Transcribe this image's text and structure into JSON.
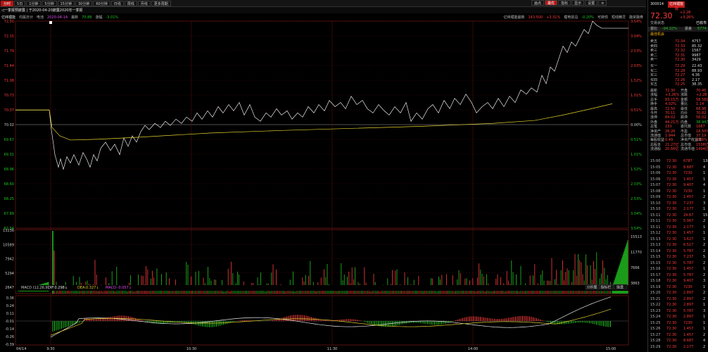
{
  "toolbar": {
    "items": [
      "分时",
      "5日",
      "1分钟",
      "5分钟",
      "15分钟",
      "30分钟",
      "60分钟",
      "日线",
      "周线",
      "月线",
      "更多周期"
    ],
    "active": 0,
    "right_items": [
      "画点",
      "最优",
      "指标",
      "显示",
      "设置",
      "≡"
    ],
    "right_active": 1
  },
  "infobar": {
    "back": "◁一季报预披露 | 于2020-04-20披露2020年一季报",
    "name": "亿纬锂能",
    "trend": "均属日计",
    "vol_label": "电池",
    "date_hint": "2020-04-14",
    "last_label": "最新",
    "last": "70.88",
    "change_label": "涨幅",
    "change": "-3.01%",
    "right_label": "亿纬锂能最新",
    "right_value": "143.500",
    "right_change": "+3.31%",
    "sector_label": "锂电前沿",
    "sector_change": "-0.20%",
    "tabs": [
      "可转债",
      "短线精灵",
      "融资融券"
    ]
  },
  "main_chart": {
    "y_left": [
      "72.50",
      "72.15",
      "71.79",
      "71.44",
      "71.08",
      "70.73",
      "70.37",
      "70.02",
      "69.67",
      "69.31",
      "68.96",
      "68.60",
      "68.25",
      "67.89",
      "67.54"
    ],
    "y_right": [
      "3.54%",
      "3.04%",
      "2.53%",
      "2.03%",
      "1.52%",
      "1.01%",
      "0.51%",
      "0.00%",
      "0.51%",
      "1.01%",
      "1.52%",
      "2.03%",
      "2.53%",
      "3.04%",
      "3.54%"
    ],
    "prev_close": 70.02,
    "ylim": [
      67.54,
      72.5
    ]
  },
  "vol_chart": {
    "y_left": [
      "13236",
      "10589",
      "7942",
      "5294",
      "2647"
    ],
    "y_right": [
      "15513",
      "11770",
      "7666",
      "3863"
    ]
  },
  "macd": {
    "label": "MACD (12,26,9)",
    "dif_label": "DIF:",
    "dif": "0.298↓",
    "dea_label": "DEA:",
    "dea": "0.327↓",
    "macd_label": "MACD:",
    "macd": "-0.057↓",
    "y_left": [
      "0.36",
      "0.24",
      "0.11",
      "-0.01",
      "-0.14",
      "-0.26",
      "-0.39"
    ],
    "bottom_tabs": [
      "分析图",
      "指标栏",
      "操盘"
    ]
  },
  "time_axis": [
    "04/14",
    "9:30",
    "10:30",
    "11:30",
    "14:00",
    "15:00"
  ],
  "sidebar": {
    "code": "300014",
    "name": "亿纬锂能",
    "alt": "融",
    "price": "72.30",
    "chg": "+2.28",
    "pct": "+3.26%",
    "status_label": "交易状态",
    "status": "已收市",
    "weibi_label": "委比",
    "weibi": "-94.32%",
    "weicha_label": "委差",
    "weicha": "6774",
    "marked_label": "最佳机会",
    "marked2": "新品发布",
    "asks": [
      [
        "卖五",
        "72.34",
        "4757"
      ],
      [
        "卖四",
        "72.33",
        "85.32"
      ],
      [
        "卖三",
        "72.32",
        "1567"
      ],
      [
        "卖二",
        "72.31",
        "9987"
      ],
      [
        "卖一",
        "72.30",
        "3429"
      ]
    ],
    "bids": [
      [
        "买一",
        "72.29",
        "22.43"
      ],
      [
        "买二",
        "72.28",
        "88.93"
      ],
      [
        "买三",
        "72.27",
        "4.36"
      ],
      [
        "买四",
        "72.26",
        "2.17"
      ],
      [
        "买五",
        "72.25",
        "38.35"
      ]
    ],
    "stats": [
      [
        "最新",
        "72.30",
        "开盘",
        "70.45"
      ],
      [
        "涨幅",
        "+3.26%",
        "涨跌",
        "+2.28"
      ],
      [
        "总手",
        "83.15万",
        "金额",
        "58.58亿"
      ],
      [
        "换手",
        "4.02%",
        "量比",
        "1.14"
      ],
      [
        "最高",
        "72.50",
        "最低",
        "68.98"
      ],
      [
        "今开",
        "70.11",
        "均价",
        "70.82"
      ],
      [
        "涨停",
        "84.02",
        "跌停",
        "56.02"
      ],
      [
        "外盘",
        "44.21万",
        "内盘",
        "38.94万"
      ],
      [
        "总笔",
        "233",
        "委托数",
        "1687"
      ],
      [
        "净资产",
        "28.26",
        "市盈",
        "18.50%"
      ],
      [
        "流通值",
        "1.944",
        "总市值",
        "37.19"
      ],
      [
        "每股收益",
        "0.49",
        "净资产收益率",
        "0.66%"
      ],
      [
        "总股本",
        "21.27亿",
        "总市值",
        "1538亿"
      ],
      [
        "流通股",
        "20.66亿",
        "流通市值",
        "1494亿"
      ]
    ],
    "ticks": [
      [
        "15:00",
        "72.30",
        "6787",
        "1383"
      ],
      [
        "15:05",
        "72.30",
        "8.687",
        "4"
      ],
      [
        "15:06",
        "72.30",
        "7230",
        "1"
      ],
      [
        "15:06",
        "72.30",
        "1.457",
        "1"
      ],
      [
        "15:07",
        "72.30",
        "9.407",
        "4"
      ],
      [
        "15:08",
        "72.30",
        "7230",
        "1"
      ],
      [
        "15:09",
        "72.30",
        "1.457",
        "2"
      ],
      [
        "15:10",
        "72.30",
        "7.237",
        "3"
      ],
      [
        "15:10",
        "72.30",
        "2.177",
        "1"
      ],
      [
        "15:11",
        "72.30",
        "29.67",
        "15"
      ],
      [
        "15:11",
        "72.30",
        "5.067",
        "2"
      ],
      [
        "15:11",
        "72.30",
        "2.177",
        "1"
      ],
      [
        "15:12",
        "72.30",
        "1.457",
        "1"
      ],
      [
        "15:13",
        "72.30",
        "3.627",
        "1"
      ],
      [
        "15:13",
        "72.30",
        "6.517",
        "2"
      ],
      [
        "15:14",
        "72.30",
        "5.787",
        "2"
      ],
      [
        "15:15",
        "72.30",
        "7.237",
        "5"
      ],
      [
        "15:15",
        "72.30",
        "5.787",
        "2"
      ],
      [
        "15:16",
        "72.30",
        "1.457",
        "1"
      ],
      [
        "15:17",
        "72.30",
        "5.787",
        "2"
      ],
      [
        "15:18",
        "72.30",
        "9.407",
        "3"
      ],
      [
        "15:19",
        "72.30",
        "7230",
        "1"
      ],
      [
        "15:20",
        "72.30",
        "2.897",
        "2"
      ],
      [
        "15:21",
        "72.30",
        "2.897",
        "2"
      ],
      [
        "15:22",
        "72.30",
        "2.897",
        "1"
      ],
      [
        "15:23",
        "72.30",
        "5.787",
        "3"
      ],
      [
        "15:24",
        "72.30",
        "2.897",
        "1"
      ],
      [
        "15:25",
        "72.30",
        "7230",
        "1"
      ],
      [
        "15:26",
        "72.30",
        "1.457",
        "1"
      ],
      [
        "15:27",
        "72.30",
        "1.457",
        "2"
      ],
      [
        "15:28",
        "72.30",
        "8.687",
        "4"
      ],
      [
        "15:29",
        "72.30",
        "2.177",
        "2"
      ]
    ]
  },
  "colors": {
    "up": "#ff3b3b",
    "down": "#21c421",
    "avg": "#e5d22c",
    "price": "#e8e8e8",
    "grid": "#3a0d0d"
  }
}
